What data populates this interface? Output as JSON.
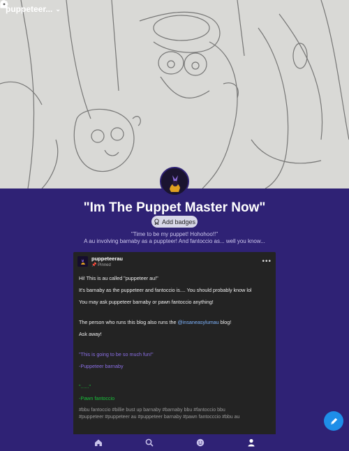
{
  "topbar": {
    "blog_title": "puppeteer...",
    "icons": [
      "search-icon",
      "flask-icon",
      "palette-icon",
      "share-icon",
      "gear-icon"
    ]
  },
  "blog": {
    "name": "\"Im The Puppet Master Now\"",
    "add_badges_label": "Add badges",
    "description_line1": "\"Time to be my puppet! Hohohoo!!\"",
    "description_line2": "A au involving barnaby as a puppteer! And fantoccio as... well you know..."
  },
  "post": {
    "username": "puppeteerau",
    "pinned_label": "Pinned",
    "paragraphs": [
      "Hi! This is au called \"puppeteer au!\"",
      "It's barnaby as the puppeteer and fantoccio is.... You should probably know lol",
      "You may ask puppeteer barnaby or pawn fantoccio anything!"
    ],
    "runs_prefix": "The person who runs this blog also runs the ",
    "runs_link": "@insaneasylumau",
    "runs_suffix": " blog!",
    "ask_away": "Ask away!",
    "quote1": "\"This is going to be so much fun!\"",
    "sign1": "-Puppeteer barnaby",
    "quote2": "\"......\"",
    "sign2": "-Pawn fantoccio",
    "tags_line1": "#bbu fantoccio  #billie bust up barnaby  #barnaby bbu  #fantoccio bbu",
    "tags_line2": "#puppeteer  #puppeteer au  #puppeteer barnaby  #pawn fantocccio  #bbu au"
  },
  "bottom_nav": [
    "home-icon",
    "search-icon",
    "smiley-icon",
    "person-icon"
  ],
  "colors": {
    "background": "#2f2275",
    "card": "#232323",
    "link": "#7fb5ff",
    "purple_text": "#8b6fe6",
    "green_text": "#18c33a",
    "fab": "#1e8ee8"
  }
}
